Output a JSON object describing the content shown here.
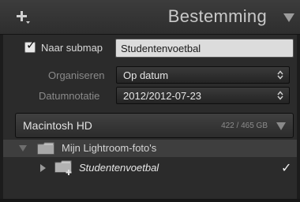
{
  "header": {
    "title": "Bestemming",
    "add_icon": "plus-icon",
    "collapse_icon": "triangle-down-icon"
  },
  "subfolder": {
    "checked": true,
    "checkmark": "✓",
    "label": "Naar submap",
    "value": "Studentenvoetbal"
  },
  "organize": {
    "label": "Organiseren",
    "selected": "Op datum"
  },
  "date_format": {
    "label": "Datumnotatie",
    "selected": "2012/2012-07-23"
  },
  "volume": {
    "name": "Macintosh HD",
    "size": "422 / 465 GB"
  },
  "tree": {
    "root_folder": "Mijn Lightroom-foto's",
    "child_folder": "Studentenvoetbal",
    "child_checkmark": "✓"
  },
  "colors": {
    "panel": "#2b2b2b",
    "header": "#353535",
    "selected_row": "#3e3e3e",
    "text": "#d4d4d4"
  }
}
